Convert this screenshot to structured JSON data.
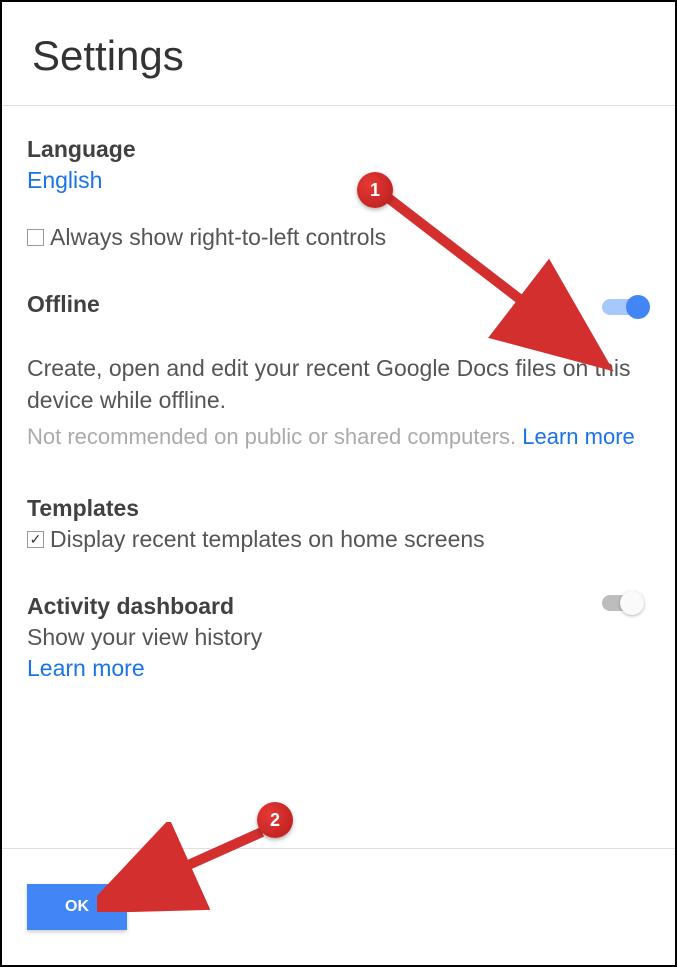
{
  "header": {
    "title": "Settings"
  },
  "language": {
    "label": "Language",
    "value": "English",
    "rtl_checkbox_label": "Always show right-to-left controls",
    "rtl_checked": false
  },
  "offline": {
    "label": "Offline",
    "toggle_on": true,
    "description": "Create, open and edit your recent Google Docs files on this device while offline.",
    "subtext_prefix": "Not recommended on public or shared computers. ",
    "learn_more": "Learn more"
  },
  "templates": {
    "label": "Templates",
    "checkbox_label": "Display recent templates on home screens",
    "checked": true
  },
  "activity": {
    "label": "Activity dashboard",
    "description": "Show your view history",
    "learn_more": "Learn more",
    "toggle_on": false
  },
  "footer": {
    "ok_label": "OK"
  },
  "callouts": {
    "one": "1",
    "two": "2"
  }
}
